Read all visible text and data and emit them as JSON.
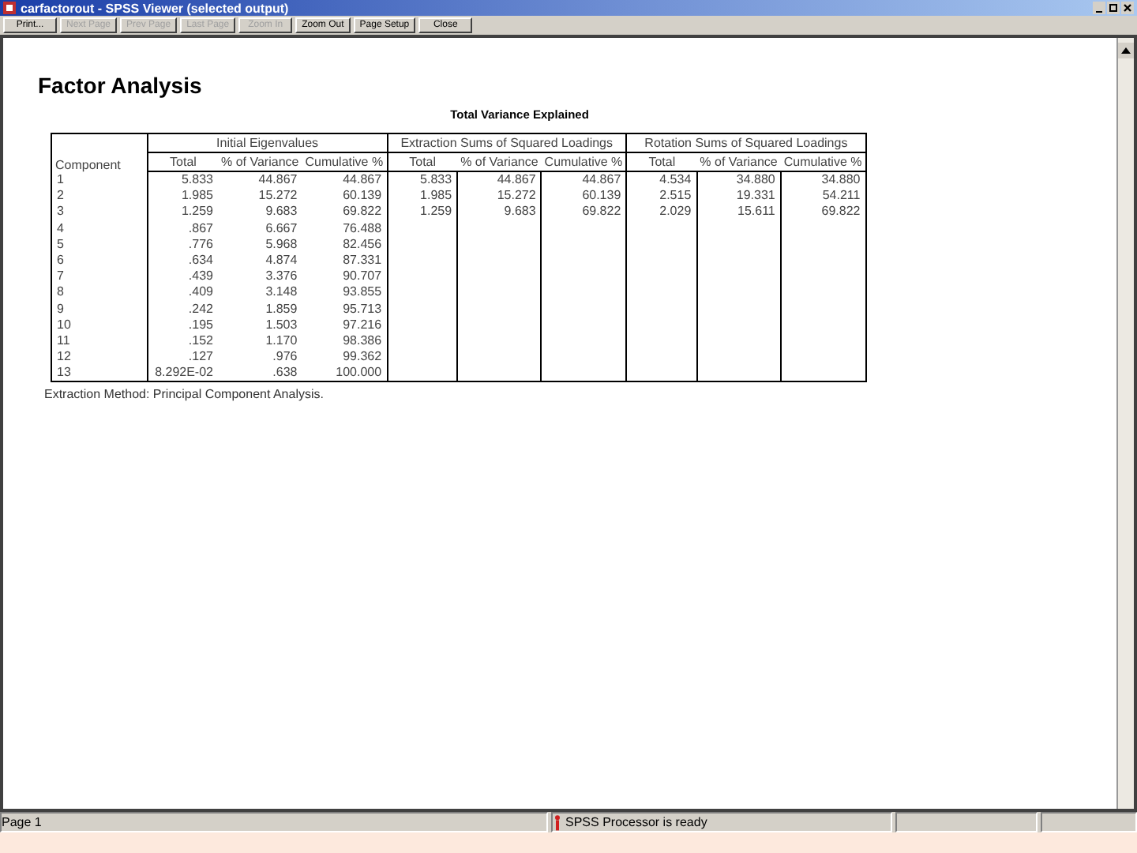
{
  "window": {
    "title": "carfactorout - SPSS Viewer (selected output)"
  },
  "toolbar": [
    {
      "label": "Print...",
      "disabled": false
    },
    {
      "label": "Next Page",
      "disabled": true
    },
    {
      "label": "Prev Page",
      "disabled": true
    },
    {
      "label": "Last Page",
      "disabled": true
    },
    {
      "label": "Zoom In",
      "disabled": true
    },
    {
      "label": "Zoom Out",
      "disabled": false
    },
    {
      "label": "Page Setup",
      "disabled": false
    },
    {
      "label": "Close",
      "disabled": false
    }
  ],
  "output": {
    "heading": "Factor Analysis",
    "table": {
      "title": "Total Variance Explained",
      "row_header": "Component",
      "groups": [
        "Initial Eigenvalues",
        "Extraction Sums of Squared Loadings",
        "Rotation Sums of Squared Loadings"
      ],
      "columns": [
        "Total",
        "% of Variance",
        "Cumulative %",
        "Total",
        "% of Variance",
        "Cumulative %",
        "Total",
        "% of Variance",
        "Cumulative %"
      ],
      "rows": [
        {
          "component": "1",
          "cells": [
            "5.833",
            "44.867",
            "44.867",
            "5.833",
            "44.867",
            "44.867",
            "4.534",
            "34.880",
            "34.880"
          ]
        },
        {
          "component": "2",
          "cells": [
            "1.985",
            "15.272",
            "60.139",
            "1.985",
            "15.272",
            "60.139",
            "2.515",
            "19.331",
            "54.211"
          ]
        },
        {
          "component": "3",
          "cells": [
            "1.259",
            "9.683",
            "69.822",
            "1.259",
            "9.683",
            "69.822",
            "2.029",
            "15.611",
            "69.822"
          ]
        },
        {
          "component": "4",
          "cells": [
            ".867",
            "6.667",
            "76.488"
          ]
        },
        {
          "component": "5",
          "cells": [
            ".776",
            "5.968",
            "82.456"
          ]
        },
        {
          "component": "6",
          "cells": [
            ".634",
            "4.874",
            "87.331"
          ]
        },
        {
          "component": "7",
          "cells": [
            ".439",
            "3.376",
            "90.707"
          ]
        },
        {
          "component": "8",
          "cells": [
            ".409",
            "3.148",
            "93.855"
          ]
        },
        {
          "component": "9",
          "cells": [
            ".242",
            "1.859",
            "95.713"
          ]
        },
        {
          "component": "10",
          "cells": [
            ".195",
            "1.503",
            "97.216"
          ]
        },
        {
          "component": "11",
          "cells": [
            ".152",
            "1.170",
            "98.386"
          ]
        },
        {
          "component": "12",
          "cells": [
            ".127",
            ".976",
            "99.362"
          ]
        },
        {
          "component": "13",
          "cells": [
            "8.292E-02",
            ".638",
            "100.000"
          ]
        }
      ],
      "footnote": "Extraction Method: Principal Component Analysis."
    }
  },
  "status_bar": {
    "page": "Page 1",
    "processor": "SPSS Processor  is ready"
  }
}
